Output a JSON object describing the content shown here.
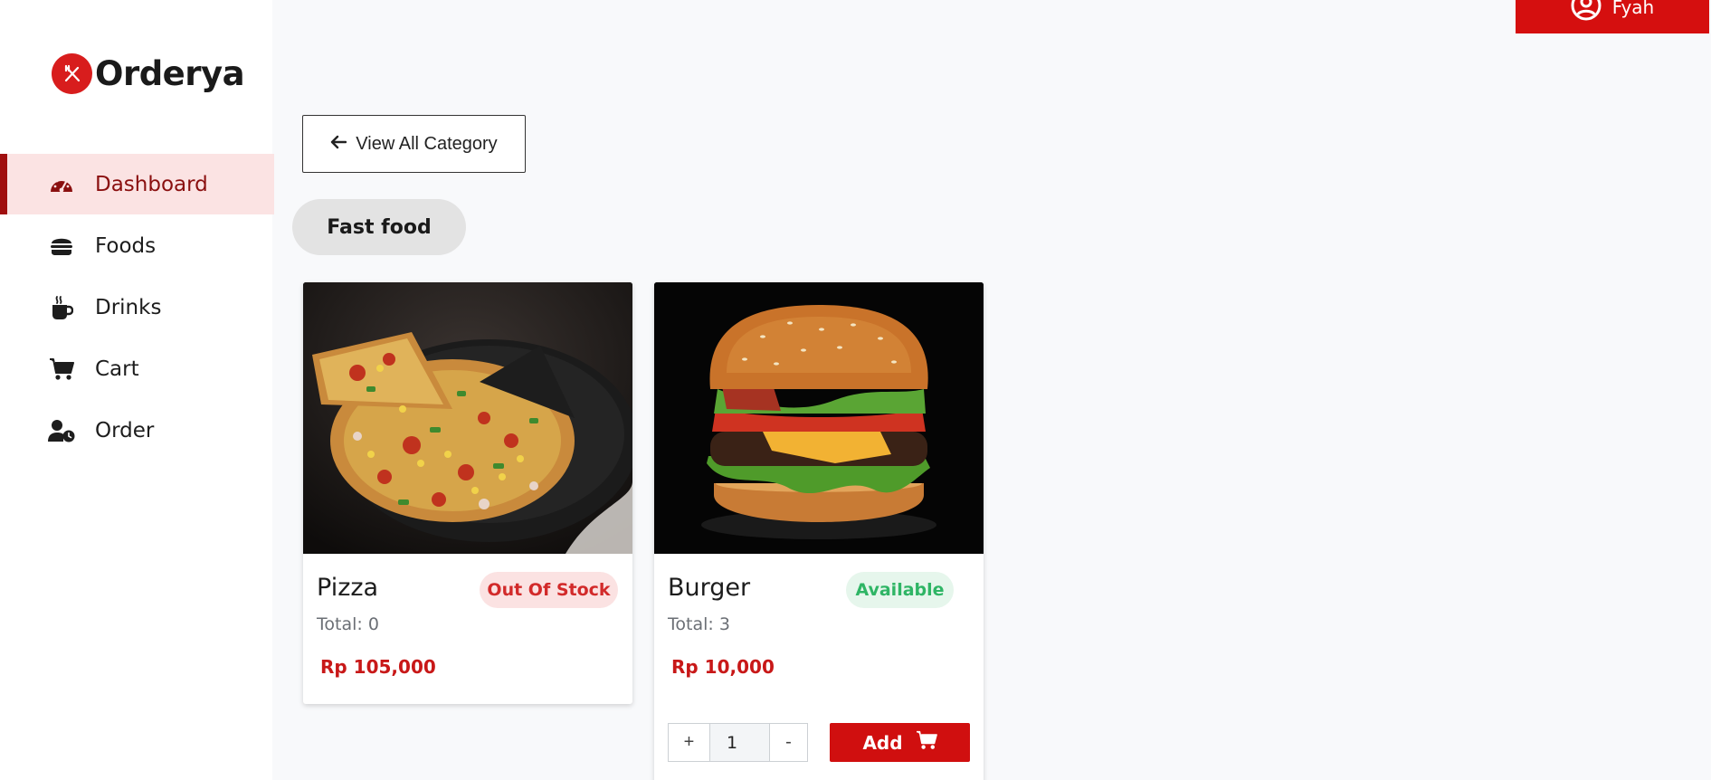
{
  "brand": {
    "name": "Orderya",
    "logo_icon": "fork-knife-icon",
    "color": "#d81d1d"
  },
  "user": {
    "name": "Fyah",
    "icon": "user-circle-icon"
  },
  "sidebar": {
    "items": [
      {
        "label": "Dashboard",
        "icon": "speedometer-icon",
        "active": true
      },
      {
        "label": "Foods",
        "icon": "burger-icon",
        "active": false
      },
      {
        "label": "Drinks",
        "icon": "coffee-cup-icon",
        "active": false
      },
      {
        "label": "Cart",
        "icon": "cart-icon",
        "active": false
      },
      {
        "label": "Order",
        "icon": "user-clock-icon",
        "active": false
      }
    ]
  },
  "main": {
    "back_label": "View All Category",
    "category": "Fast food",
    "products": [
      {
        "name": "Pizza",
        "status": "Out Of Stock",
        "total": "Total: 0",
        "price": "Rp 105,000"
      },
      {
        "name": "Burger",
        "status": "Available",
        "total": "Total: 3",
        "price": "Rp 10,000",
        "quantity": "1",
        "plus_label": "+",
        "minus_label": "-",
        "add_label": "Add"
      }
    ]
  },
  "colors": {
    "accent": "#d50f0f",
    "active_bg": "#fbe3e3",
    "active_bar": "#a00f0f",
    "out_of_stock": "#d22a2a",
    "available": "#2fb565"
  }
}
